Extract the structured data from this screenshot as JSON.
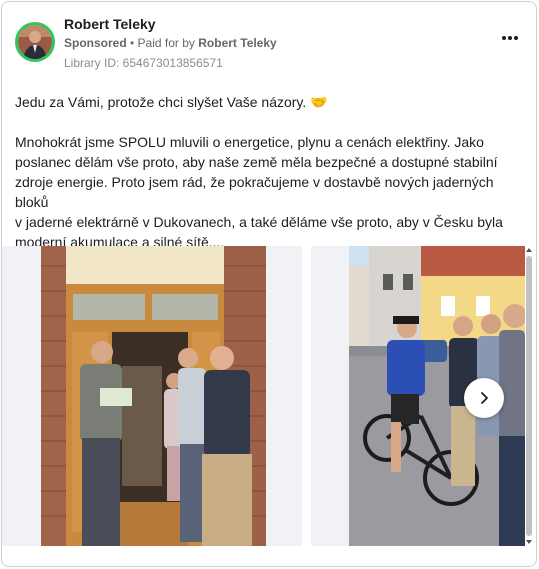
{
  "post": {
    "author": "Robert Teleky",
    "sponsored_label": "Sponsored",
    "paid_prefix": "• Paid for by",
    "paid_by": "Robert Teleky",
    "library_id": "Library ID: 654673013856571",
    "body": {
      "line1": "Jedu za Vámi, protože chci slyšet Vaše názory.",
      "emoji": "🤝",
      "para2_l1": "Mnohokrát jsme SPOLU mluvili o energetice, plynu a cenách elektřiny. Jako",
      "para2_l2": "poslanec dělám vše proto, aby naše země měla bezpečné a dostupné stabilní",
      "para2_l3": "zdroje energie. Proto jsem rád, že pokračujeme v dostavbě nových jaderných bloků",
      "para2_l4": "v jaderné elektrárně v Dukovanech, a také děláme vše proto, aby v Česku byla",
      "para2_l5": "moderní akumulace a silné sítě...."
    }
  },
  "carousel": {
    "slides": [
      {
        "subject": "doorway-conversation"
      },
      {
        "subject": "street-handshake-bicycle"
      }
    ],
    "next_icon": "chevron-right-icon"
  },
  "colors": {
    "avatar_ring": "#31c55b",
    "muted_text": "#65676b",
    "border": "#ced0d4"
  }
}
